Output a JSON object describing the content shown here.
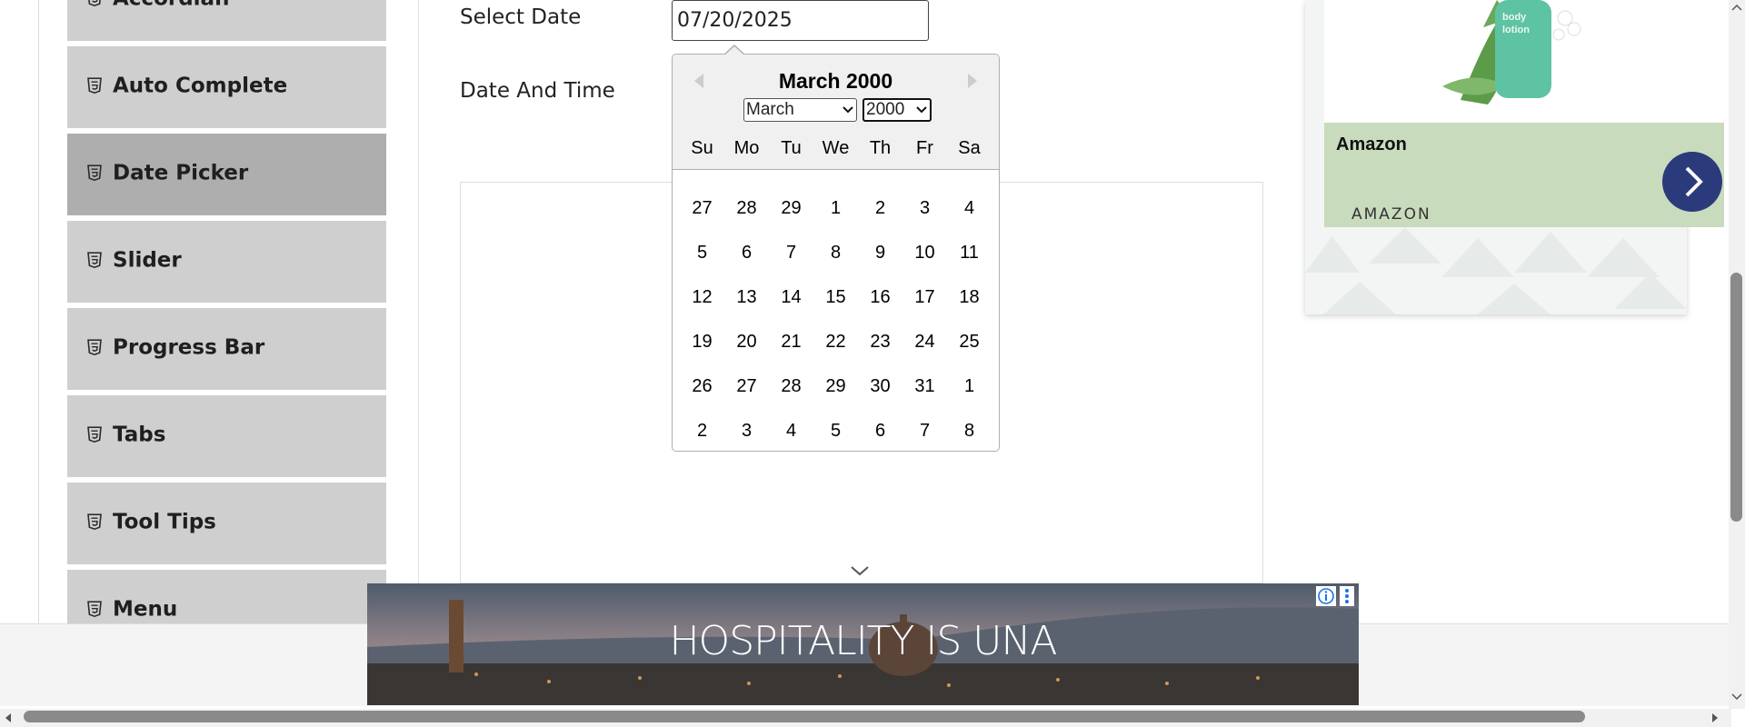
{
  "sidebar": {
    "items": [
      {
        "label": "Accordian",
        "active": false
      },
      {
        "label": "Auto Complete",
        "active": false
      },
      {
        "label": "Date Picker",
        "active": true
      },
      {
        "label": "Slider",
        "active": false
      },
      {
        "label": "Progress Bar",
        "active": false
      },
      {
        "label": "Tabs",
        "active": false
      },
      {
        "label": "Tool Tips",
        "active": false
      },
      {
        "label": "Menu",
        "active": false
      }
    ],
    "item_icon": "html5-icon"
  },
  "form": {
    "select_date_label": "Select Date",
    "date_and_time_label": "Date And Time",
    "select_date_value": "07/20/2025"
  },
  "datepicker": {
    "title": "March 2000",
    "month_selected": "March",
    "year_selected": "2000",
    "days_of_week": [
      "Su",
      "Mo",
      "Tu",
      "We",
      "Th",
      "Fr",
      "Sa"
    ],
    "weeks": [
      [
        "27",
        "28",
        "29",
        "1",
        "2",
        "3",
        "4"
      ],
      [
        "5",
        "6",
        "7",
        "8",
        "9",
        "10",
        "11"
      ],
      [
        "12",
        "13",
        "14",
        "15",
        "16",
        "17",
        "18"
      ],
      [
        "19",
        "20",
        "21",
        "22",
        "23",
        "24",
        "25"
      ],
      [
        "26",
        "27",
        "28",
        "29",
        "30",
        "31",
        "1"
      ],
      [
        "2",
        "3",
        "4",
        "5",
        "6",
        "7",
        "8"
      ]
    ],
    "prev_icon": "triangle-left-icon",
    "next_icon": "triangle-right-icon"
  },
  "ad_right": {
    "brand": "Amazon",
    "domain": "AMAZON",
    "product_text": "body lotion",
    "go_icon": "chevron-right-icon",
    "colors": {
      "band": "#c8dbbd",
      "button": "#2b3a7a"
    }
  },
  "ad_banner": {
    "text": "HOSPITALITY IS UNA",
    "info_icon": "info-icon",
    "menu_icon": "kebab-menu-icon"
  },
  "colors": {
    "sidebar_item": "#cfcfcf",
    "sidebar_active": "#aeaeae",
    "datepicker_header": "#f0f0f0"
  }
}
